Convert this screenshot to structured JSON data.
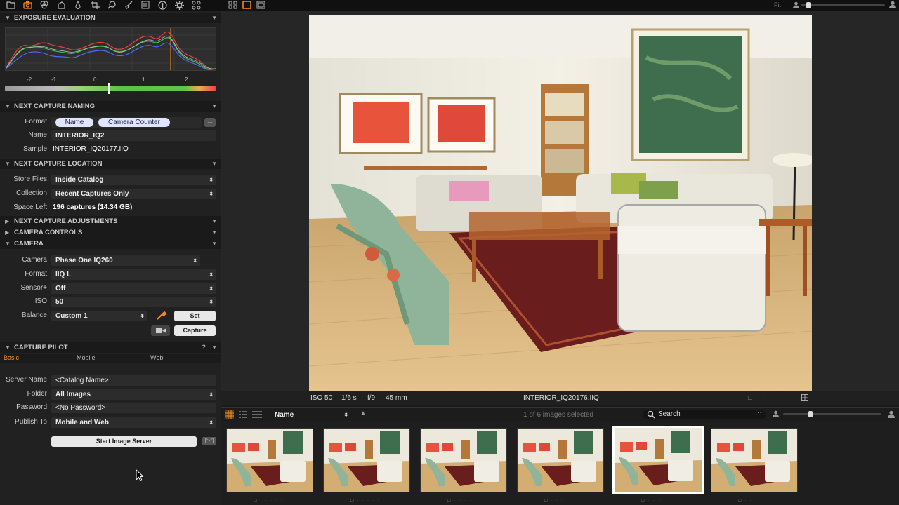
{
  "toolbar": {
    "icons": [
      "folder-icon",
      "camera-icon",
      "color-balance-icon",
      "shape-icon",
      "drop-icon",
      "crop-icon",
      "magnifier-icon",
      "brush-icon",
      "metadata-icon",
      "info-icon",
      "gear-icon",
      "batch-icon"
    ],
    "view_icons": [
      "grid-view-icon",
      "single-view-icon",
      "fullscreen-icon"
    ],
    "fit_label": "Fit"
  },
  "exposure": {
    "title": "EXPOSURE EVALUATION",
    "ev_ticks": [
      "-2",
      "-1",
      "0",
      "1",
      "2"
    ],
    "ev_value": 0.15
  },
  "naming": {
    "title": "NEXT CAPTURE NAMING",
    "format_label": "Format",
    "format_tokens": [
      "Name",
      "Camera Counter"
    ],
    "more_button": "...",
    "name_label": "Name",
    "name_value": "INTERIOR_IQ2",
    "sample_label": "Sample",
    "sample_value": "INTERIOR_IQ20177.IIQ"
  },
  "location": {
    "title": "NEXT CAPTURE LOCATION",
    "store_label": "Store Files",
    "store_value": "Inside Catalog",
    "collection_label": "Collection",
    "collection_value": "Recent Captures Only",
    "space_label": "Space Left",
    "space_value": "196 captures (14.34 GB)"
  },
  "collapsed_sections": {
    "adjustments": "NEXT CAPTURE ADJUSTMENTS",
    "controls": "CAMERA CONTROLS"
  },
  "camera": {
    "title": "CAMERA",
    "camera_label": "Camera",
    "camera_value": "Phase One IQ260",
    "format_label": "Format",
    "format_value": "IIQ L",
    "sensor_label": "Sensor+",
    "sensor_value": "Off",
    "iso_label": "ISO",
    "iso_value": "50",
    "balance_label": "Balance",
    "balance_value": "Custom 1",
    "set_button": "Set",
    "capture_button": "Capture"
  },
  "pilot": {
    "title": "CAPTURE PILOT",
    "help": "?",
    "tabs": [
      "Basic",
      "Mobile",
      "Web"
    ],
    "server_label": "Server Name",
    "server_value": "<Catalog Name>",
    "folder_label": "Folder",
    "folder_value": "All Images",
    "password_label": "Password",
    "password_value": "<No Password>",
    "publish_label": "Publish To",
    "publish_value": "Mobile and Web",
    "start_button": "Start Image Server"
  },
  "viewer": {
    "iso": "ISO 50",
    "shutter": "1/6 s",
    "aperture": "f/9",
    "focal": "45 mm",
    "filename": "INTERIOR_IQ20176.IIQ"
  },
  "browser": {
    "sort_value": "Name",
    "selection_status": "1 of 6 images selected",
    "search_placeholder": "Search",
    "thumbnail_count": 6,
    "selected_index": 4
  }
}
